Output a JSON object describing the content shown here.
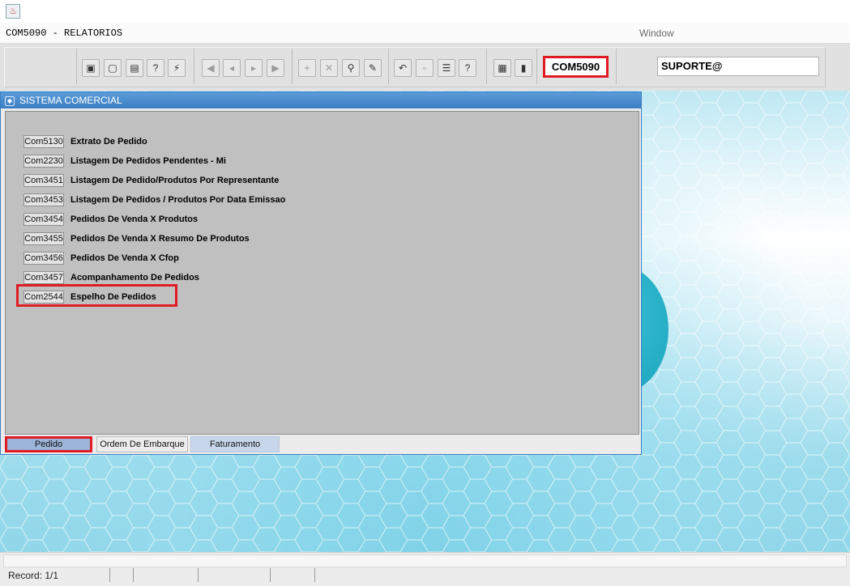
{
  "menubar": {
    "form_title": "COM5090 - RELATORIOS",
    "window_menu": "Window"
  },
  "toolbar": {
    "form_name": "COM5090",
    "user": "SUPORTE@",
    "icons": [
      "save-icon",
      "print-preview-icon",
      "print-icon",
      "help-query-icon",
      "execute-query-icon",
      "first-record-icon",
      "previous-record-icon",
      "next-record-icon",
      "last-record-icon",
      "insert-record-icon",
      "delete-record-icon",
      "lookup-icon",
      "clear-icon",
      "undo-icon",
      "copy-icon",
      "list-values-icon",
      "help-icon",
      "menu-icon",
      "exit-icon"
    ]
  },
  "panel": {
    "title": "SISTEMA COMERCIAL",
    "items": [
      {
        "code": "Com5130",
        "label": "Extrato De Pedido"
      },
      {
        "code": "Com2230",
        "label": "Listagem De Pedidos Pendentes - Mi"
      },
      {
        "code": "Com3451",
        "label": "Listagem De Pedido/Produtos Por Representante"
      },
      {
        "code": "Com3453",
        "label": "Listagem De Pedidos / Produtos Por Data Emissao"
      },
      {
        "code": "Com3454",
        "label": "Pedidos De Venda X Produtos"
      },
      {
        "code": "Com3455",
        "label": "Pedidos De Venda X Resumo De Produtos"
      },
      {
        "code": "Com3456",
        "label": "Pedidos De Venda X Cfop"
      },
      {
        "code": "Com3457",
        "label": "Acompanhamento De Pedidos"
      },
      {
        "code": "Com2544",
        "label": "Espelho De Pedidos"
      }
    ],
    "tabs": [
      "Pedido",
      "Ordem De Embarque",
      "Faturamento"
    ]
  },
  "status": {
    "record": "Record: 1/1"
  },
  "colors": {
    "highlight": "#e01b24",
    "title_bar": "#3b7fc3",
    "panel_body": "#c0c0c0",
    "active_tab": "#9bb4d8"
  }
}
